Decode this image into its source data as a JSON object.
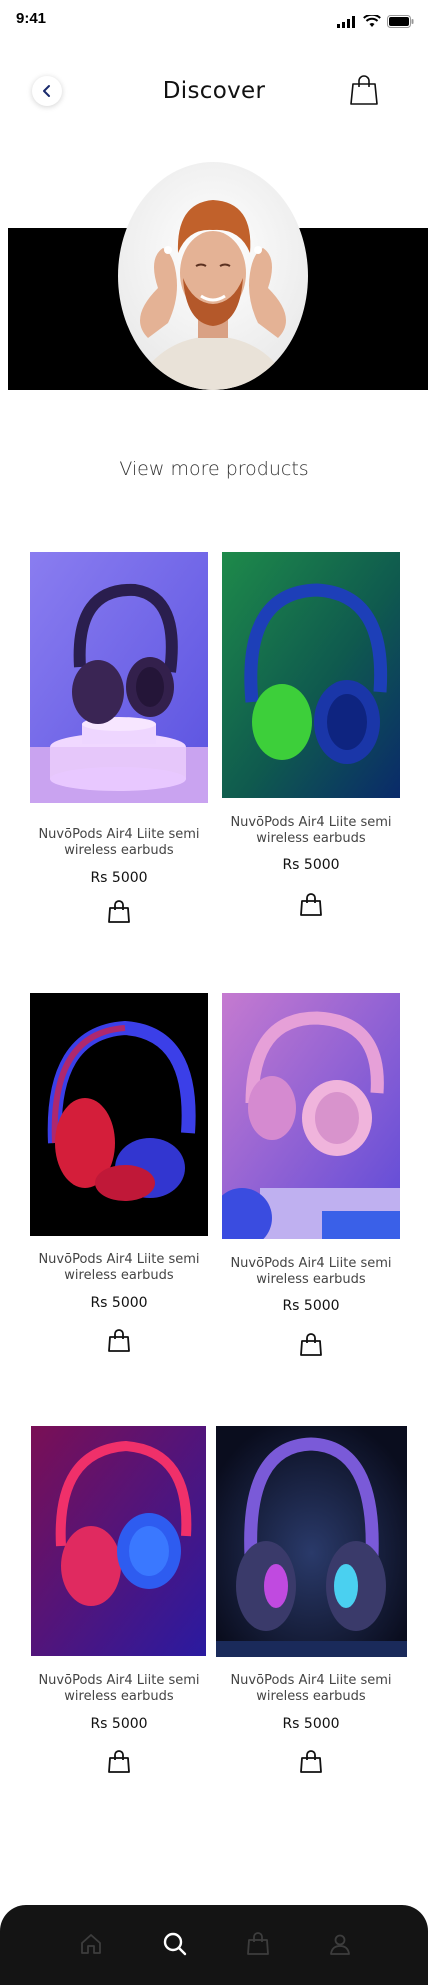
{
  "status": {
    "time": "9:41"
  },
  "header": {
    "title": "Discover"
  },
  "section": {
    "view_more": "View more products"
  },
  "products": [
    {
      "name": "NuvōPods Air4 Liite semi wireless earbuds",
      "price": "Rs 5000"
    },
    {
      "name": "NuvōPods Air4 Liite semi wireless earbuds",
      "price": "Rs 5000"
    },
    {
      "name": "NuvōPods Air4 Liite semi wireless earbuds",
      "price": "Rs 5000"
    },
    {
      "name": "NuvōPods Air4 Liite semi wireless earbuds",
      "price": "Rs 5000"
    },
    {
      "name": "NuvōPods Air4 Liite semi wireless earbuds",
      "price": "Rs 5000"
    },
    {
      "name": "NuvōPods Air4 Liite semi wireless earbuds",
      "price": "Rs 5000"
    }
  ],
  "nav": {
    "items": [
      "home-icon",
      "search-icon",
      "bag-icon",
      "profile-icon"
    ],
    "active": "search-icon"
  },
  "colors": {
    "nav_bg": "#141414",
    "active_icon": "#ffffff",
    "inactive_icon": "#3d3d3d"
  }
}
